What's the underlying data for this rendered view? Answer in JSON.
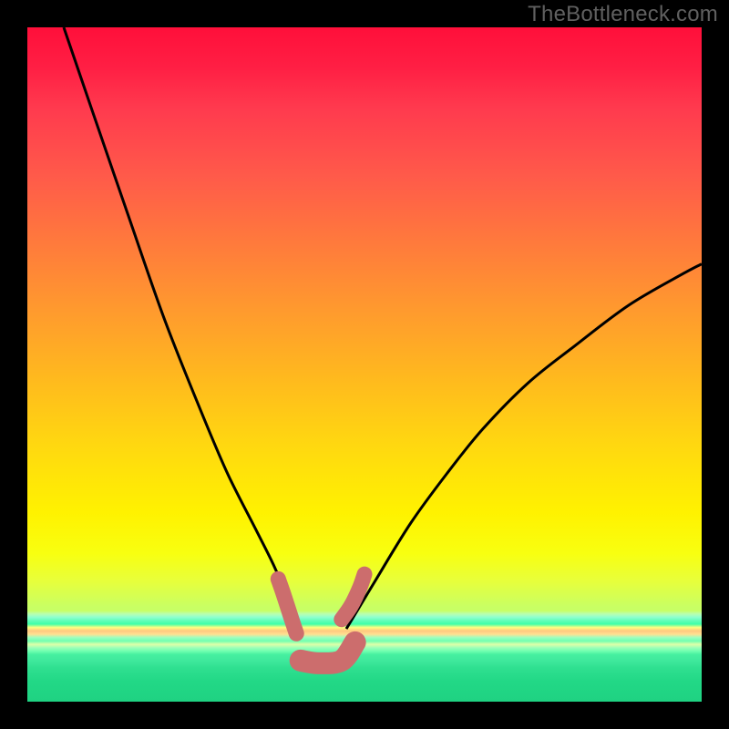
{
  "watermark": "TheBottleneck.com",
  "chart_data": {
    "type": "line",
    "title": "",
    "xlabel": "",
    "ylabel": "",
    "xlim": [
      0,
      100
    ],
    "ylim": [
      0,
      100
    ],
    "grid": false,
    "legend": false,
    "note": "No numeric axis ticks or labels are visible. Curve coordinates are estimated from pixel positions, normalized to a 0–100 range on both axes (origin at bottom-left of the gradient plot area).",
    "series": [
      {
        "name": "left-curve",
        "stroke": "#000000",
        "stroke_width_px": 3,
        "points": [
          {
            "x": 5.4,
            "y": 100.0
          },
          {
            "x": 9.5,
            "y": 88.0
          },
          {
            "x": 14.9,
            "y": 72.3
          },
          {
            "x": 20.3,
            "y": 56.8
          },
          {
            "x": 25.7,
            "y": 43.2
          },
          {
            "x": 29.7,
            "y": 33.8
          },
          {
            "x": 33.8,
            "y": 25.7
          },
          {
            "x": 36.5,
            "y": 20.3
          },
          {
            "x": 38.5,
            "y": 15.5
          },
          {
            "x": 40.0,
            "y": 10.8
          }
        ]
      },
      {
        "name": "right-curve",
        "stroke": "#000000",
        "stroke_width_px": 3,
        "points": [
          {
            "x": 47.3,
            "y": 10.8
          },
          {
            "x": 51.4,
            "y": 17.6
          },
          {
            "x": 56.8,
            "y": 26.4
          },
          {
            "x": 62.2,
            "y": 33.8
          },
          {
            "x": 67.6,
            "y": 40.5
          },
          {
            "x": 74.3,
            "y": 47.3
          },
          {
            "x": 81.1,
            "y": 52.7
          },
          {
            "x": 89.2,
            "y": 58.8
          },
          {
            "x": 97.3,
            "y": 63.5
          },
          {
            "x": 100.0,
            "y": 64.9
          }
        ]
      },
      {
        "name": "pink-segment-left",
        "stroke": "#cc6d6d",
        "stroke_width_px": 17,
        "linecap": "round",
        "points": [
          {
            "x": 37.2,
            "y": 18.2
          },
          {
            "x": 38.0,
            "y": 15.9
          },
          {
            "x": 39.2,
            "y": 12.2
          },
          {
            "x": 39.9,
            "y": 10.1
          }
        ]
      },
      {
        "name": "pink-segment-bottom",
        "stroke": "#cc6d6d",
        "stroke_width_px": 24,
        "linecap": "round",
        "points": [
          {
            "x": 40.5,
            "y": 6.1
          },
          {
            "x": 43.2,
            "y": 5.7
          },
          {
            "x": 46.6,
            "y": 6.1
          },
          {
            "x": 48.6,
            "y": 8.8
          }
        ]
      },
      {
        "name": "pink-segment-right",
        "stroke": "#cc6d6d",
        "stroke_width_px": 17,
        "linecap": "round",
        "points": [
          {
            "x": 46.6,
            "y": 12.2
          },
          {
            "x": 48.0,
            "y": 14.2
          },
          {
            "x": 49.3,
            "y": 16.9
          },
          {
            "x": 50.0,
            "y": 18.9
          }
        ]
      }
    ],
    "background_gradient": {
      "direction": "top-to-bottom",
      "stops": [
        {
          "pct": 0,
          "color": "#ff0f3a"
        },
        {
          "pct": 22,
          "color": "#ff5a4a"
        },
        {
          "pct": 42,
          "color": "#ff9a2e"
        },
        {
          "pct": 62,
          "color": "#ffd810"
        },
        {
          "pct": 78,
          "color": "#f8ff10"
        },
        {
          "pct": 90,
          "color": "#9cffc0"
        },
        {
          "pct": 100,
          "color": "#1fd282"
        }
      ]
    }
  }
}
